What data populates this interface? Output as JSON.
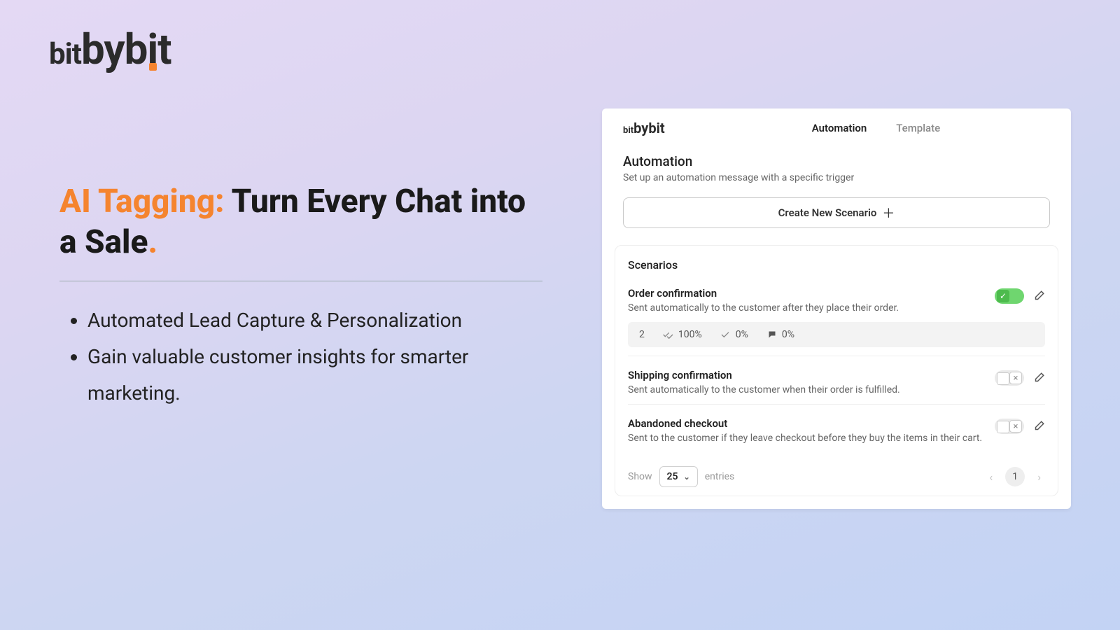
{
  "brand": {
    "part1": "bit",
    "part2": "by",
    "part3": "bit"
  },
  "headline": {
    "prefix": "AI Tagging:",
    "rest": " Turn Every Chat into a Sale",
    "dot": "."
  },
  "bullets": [
    "Automated Lead Capture & Personalization",
    "Gain valuable customer insights for smarter marketing."
  ],
  "app": {
    "tabs": {
      "automation": "Automation",
      "template": "Template"
    },
    "section": {
      "title": "Automation",
      "subtitle": "Set up an automation message with a specific trigger"
    },
    "create_button": "Create New Scenario",
    "scenarios_heading": "Scenarios",
    "scenarios": [
      {
        "title": "Order confirmation",
        "desc": "Sent automatically to the customer after they place their order.",
        "enabled": true,
        "stats": {
          "count": "2",
          "delivered": "100%",
          "read": "0%",
          "replied": "0%"
        }
      },
      {
        "title": "Shipping confirmation",
        "desc": "Sent automatically to the customer when their order is fulfilled.",
        "enabled": false
      },
      {
        "title": "Abandoned checkout",
        "desc": "Sent to the customer if they leave checkout before they buy the items in their cart.",
        "enabled": false
      }
    ],
    "pager": {
      "show_label": "Show",
      "page_size": "25",
      "entries_label": "entries",
      "current_page": "1"
    }
  }
}
